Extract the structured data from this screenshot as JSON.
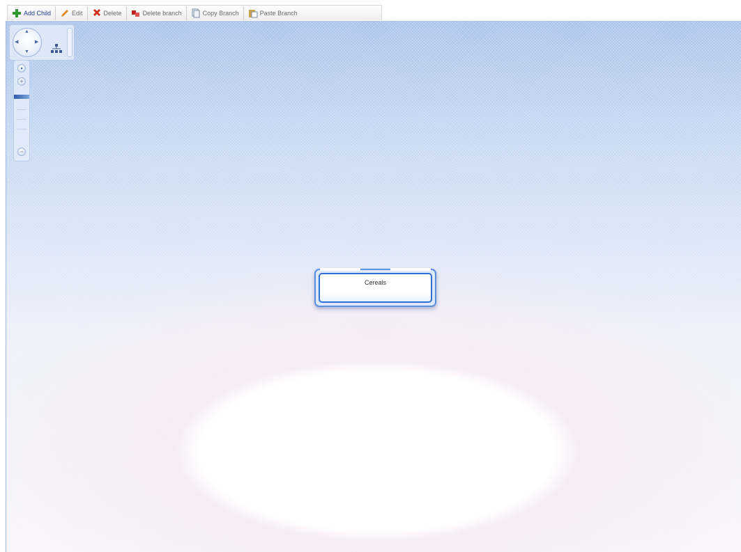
{
  "toolbar": {
    "buttons": [
      {
        "label": "Add Child",
        "icon": "plus-icon",
        "color": "#2e9b2e"
      },
      {
        "label": "Edit",
        "icon": "pencil-icon",
        "color": "#e08a1e"
      },
      {
        "label": "Delete",
        "icon": "x-icon",
        "color": "#d42a1a"
      },
      {
        "label": "Delete branch",
        "icon": "delete-branch-icon",
        "color": "#c42222"
      },
      {
        "label": "Copy Branch",
        "icon": "copy-icon",
        "color": "#7a8aa8"
      },
      {
        "label": "Paste Branch",
        "icon": "paste-icon",
        "color": "#c9a24a"
      }
    ]
  },
  "navigation": {
    "pan_icon": "pan-wheel-icon",
    "layout_icon": "tree-layout-icon"
  },
  "zoom": {
    "in_icon": "zoom-in-icon",
    "out_icon": "zoom-out-icon",
    "level": 0.8
  },
  "node": {
    "label": "Cereals"
  },
  "colors": {
    "node_border": "#2f70d6",
    "canvas_top": "#a9c3ea",
    "canvas_glow": "#fbeef6"
  }
}
